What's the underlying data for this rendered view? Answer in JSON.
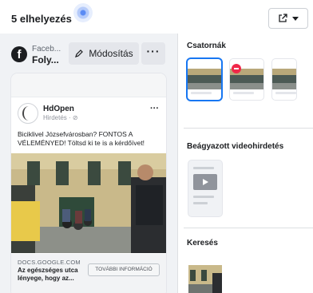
{
  "header": {
    "title": "5 elhelyezés",
    "export_icon": "external-link-icon",
    "caret_icon": "caret-down-icon"
  },
  "account": {
    "name": "Faceb...",
    "sub": "Foly...",
    "logo_icon": "facebook-logo-icon",
    "logo_letter": "f"
  },
  "toolbar": {
    "edit_label": "Módosítás",
    "edit_icon": "pencil-icon",
    "more_label": "···"
  },
  "post": {
    "page_name": "HdOpen",
    "sponsored": "Hirdetés · ⊘",
    "more": "···",
    "text": "Biciklivel Józsefvárosban? FONTOS A VÉLEMÉNYED! Töltsd ki te is a kérdőívet!",
    "link_domain": "DOCS.GOOGLE.COM",
    "link_title": "Az egészséges utca lényege, hogy az...",
    "cta_label": "TOVÁBBI INFORMÁCIÓ"
  },
  "placements": {
    "channels_title": "Csatornák",
    "embedded_video_title": "Beágyazott videohirdetés",
    "search_title": "Keresés"
  },
  "colors": {
    "accent": "#1877f2",
    "panel_bg": "#f0f2f5",
    "error_badge": "#f02849"
  }
}
